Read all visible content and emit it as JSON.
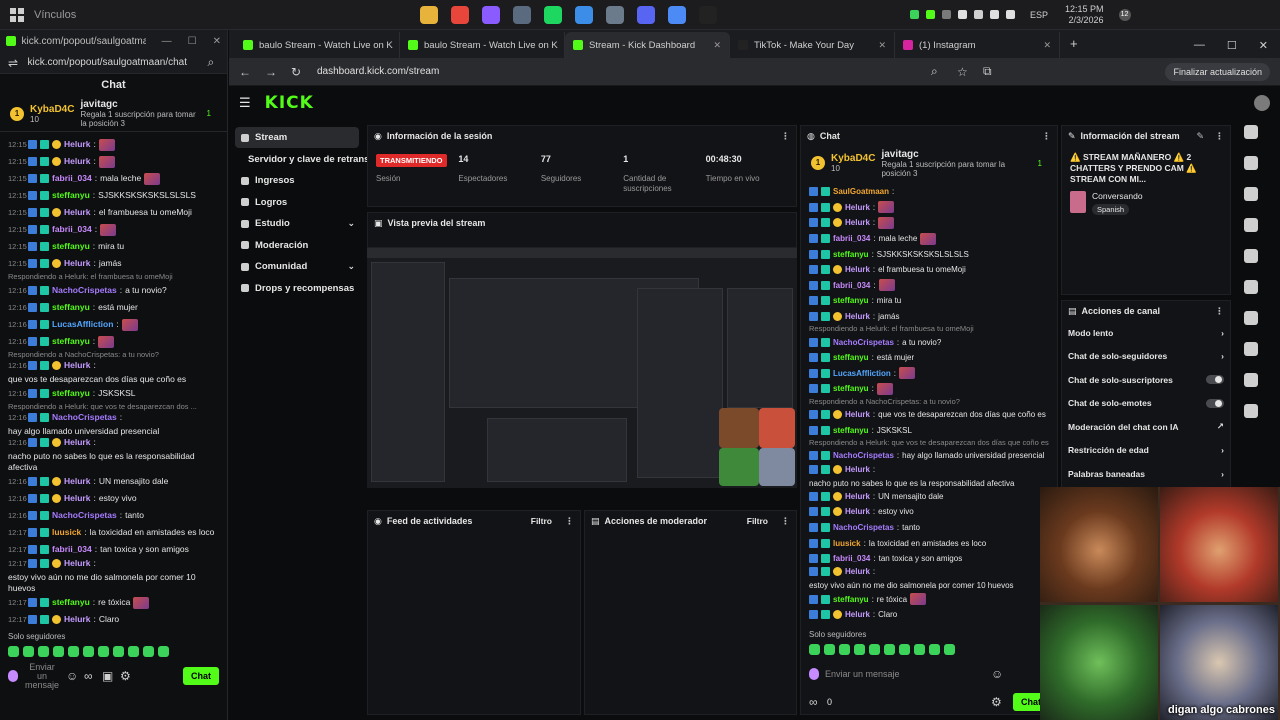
{
  "taskbar": {
    "title": "Vínculos",
    "lang": "ESP",
    "time": "12:15 PM",
    "date": "2/3/2026",
    "notif_count": "12",
    "apps": [
      "#e8b33a",
      "#e8463a",
      "#8a5cff",
      "#5a6b80",
      "#1ed760",
      "#3b8de8",
      "#6b7b8c",
      "#5865f2",
      "#4c8bf5",
      "#222222"
    ]
  },
  "popout": {
    "window_title": "kick.com/popout/saulgoatmaan...",
    "url": "kick.com/popout/saulgoatmaan/chat",
    "header": "Chat",
    "pinned_user": "KybaD4C",
    "pinned_count": "10",
    "pinned_gifter": "javitagc",
    "pinned_gift_count": "1",
    "pinned_text": "Regala 1 suscripción para tomar la posición 3",
    "messages": [
      {
        "t": "12:15",
        "user": "Helurk",
        "cls": "u-helurk",
        "text": "",
        "emote": true
      },
      {
        "t": "12:15",
        "user": "Helurk",
        "cls": "u-helurk",
        "text": "",
        "emote": true
      },
      {
        "t": "12:15",
        "user": "fabrii_034",
        "cls": "u-fabri",
        "text": "mala leche",
        "emote": true
      },
      {
        "t": "12:15",
        "user": "steffanyu",
        "cls": "u-steff",
        "text": "SJSKKSKSKSKSLSLSLS",
        "emote": false
      },
      {
        "t": "12:15",
        "user": "Helurk",
        "cls": "u-helurk",
        "text": "el frambuesa tu omeMoji",
        "emote": false
      },
      {
        "t": "12:15",
        "user": "fabrii_034",
        "cls": "u-fabri",
        "text": "",
        "emote": true
      },
      {
        "t": "12:15",
        "user": "steffanyu",
        "cls": "u-steff",
        "text": "mira tu",
        "emote": false
      },
      {
        "t": "12:15",
        "user": "Helurk",
        "cls": "u-helurk",
        "text": "jamás",
        "emote": false
      },
      {
        "reply": "Respondiendo a Helurk: el frambuesa tu omeMoji"
      },
      {
        "t": "12:16",
        "user": "NachoCrispetas",
        "cls": "u-nacho",
        "text": "a tu novio?",
        "emote": false
      },
      {
        "t": "12:16",
        "user": "steffanyu",
        "cls": "u-steff",
        "text": "está mujer",
        "emote": false
      },
      {
        "t": "12:16",
        "user": "LucasAffliction",
        "cls": "u-lucas",
        "text": "",
        "emote": true
      },
      {
        "t": "12:16",
        "user": "steffanyu",
        "cls": "u-steff",
        "text": "",
        "emote": true
      },
      {
        "reply": "Respondiendo a NachoCrispetas: a tu novio?"
      },
      {
        "t": "12:16",
        "user": "Helurk",
        "cls": "u-helurk",
        "text": "que vos te desaparezcan dos días que coño es",
        "emote": false
      },
      {
        "t": "12:16",
        "user": "steffanyu",
        "cls": "u-steff",
        "text": "JSKSKSL",
        "emote": false
      },
      {
        "reply": "Respondiendo a Helurk: que vos te desaparezcan dos ..."
      },
      {
        "t": "12:16",
        "user": "NachoCrispetas",
        "cls": "u-nacho",
        "text": "hay algo llamado universidad presencial",
        "emote": false
      },
      {
        "t": "12:16",
        "user": "Helurk",
        "cls": "u-helurk",
        "text": "nacho puto no sabes lo que es la responsabilidad afectiva",
        "emote": false
      },
      {
        "t": "12:16",
        "user": "Helurk",
        "cls": "u-helurk",
        "text": "UN mensajito dale",
        "emote": false
      },
      {
        "t": "12:16",
        "user": "Helurk",
        "cls": "u-helurk",
        "text": "estoy vivo",
        "emote": false
      },
      {
        "t": "12:16",
        "user": "NachoCrispetas",
        "cls": "u-nacho",
        "text": "tanto",
        "emote": false
      },
      {
        "t": "12:17",
        "user": "luusick",
        "cls": "u-luu",
        "text": "la toxicidad en amistades es loco",
        "emote": false
      },
      {
        "t": "12:17",
        "user": "fabrii_034",
        "cls": "u-fabri",
        "text": "tan toxica y son amigos",
        "emote": false
      },
      {
        "t": "12:17",
        "user": "Helurk",
        "cls": "u-helurk",
        "text": "estoy vivo aún no me dio salmonela por comer 10 huevos",
        "emote": false
      },
      {
        "t": "12:17",
        "user": "steffanyu",
        "cls": "u-steff",
        "text": "re tóxica",
        "emote": true
      },
      {
        "t": "12:17",
        "user": "Helurk",
        "cls": "u-helurk",
        "text": "Claro",
        "emote": false
      }
    ],
    "footer_label": "Solo seguidores",
    "input_placeholder": "Enviar un mensaje",
    "send_label": "Chat"
  },
  "browser": {
    "tabs": [
      {
        "label": "baulo Stream - Watch Live on K",
        "color": "#53fc18",
        "active": false
      },
      {
        "label": "baulo Stream - Watch Live on K",
        "color": "#53fc18",
        "active": false
      },
      {
        "label": "Stream - Kick Dashboard",
        "color": "#53fc18",
        "active": true
      },
      {
        "label": "TikTok - Make Your Day",
        "color": "#222222",
        "active": false
      },
      {
        "label": "(1) Instagram",
        "color": "#d6249f",
        "active": false
      }
    ],
    "url": "dashboard.kick.com/stream",
    "update_label": "Finalizar actualización"
  },
  "dashboard": {
    "logo": "KICK",
    "nav": [
      {
        "label": "Stream",
        "active": true,
        "chev": false
      },
      {
        "label": "Servidor y clave de retransmisión",
        "active": false,
        "chev": false
      },
      {
        "label": "Ingresos",
        "active": false,
        "chev": false
      },
      {
        "label": "Logros",
        "active": false,
        "chev": false
      },
      {
        "label": "Estudio",
        "active": false,
        "chev": true
      },
      {
        "label": "Moderación",
        "active": false,
        "chev": false
      },
      {
        "label": "Comunidad",
        "active": false,
        "chev": true
      },
      {
        "label": "Drops y recompensas",
        "active": false,
        "chev": false
      }
    ],
    "session": {
      "title": "Información de la sesión",
      "live_label": "TRANSMITIENDO",
      "session_label": "Sesión",
      "viewers": "14",
      "viewers_label": "Espectadores",
      "followers": "77",
      "followers_label": "Seguidores",
      "subs": "1",
      "subs_label": "Cantidad de suscripciones",
      "uptime": "00:48:30",
      "uptime_label": "Tiempo en vivo"
    },
    "preview_title": "Vista previa del stream",
    "feed_title": "Feed de actividades",
    "mod_title": "Acciones de moderador",
    "filter_label": "Filtro",
    "chat": {
      "title": "Chat",
      "pinned_user": "KybaD4C",
      "pinned_count": "10",
      "pinned_gifter": "javitagc",
      "pinned_gift_count": "1",
      "pinned_text": "Regala 1 suscripción para tomar la posición 3",
      "messages": [
        {
          "user": "SaulGoatmaan",
          "cls": "u-luu",
          "text": "",
          "emote": false
        },
        {
          "user": "Helurk",
          "cls": "u-helurk",
          "text": "",
          "emote": true
        },
        {
          "user": "Helurk",
          "cls": "u-helurk",
          "text": "",
          "emote": true
        },
        {
          "user": "fabrii_034",
          "cls": "u-fabri",
          "text": "mala leche",
          "emote": true
        },
        {
          "user": "steffanyu",
          "cls": "u-steff",
          "text": "SJSKKSKSKSKSLSLSLS",
          "emote": false
        },
        {
          "user": "Helurk",
          "cls": "u-helurk",
          "text": "el frambuesa tu omeMoji",
          "emote": false
        },
        {
          "user": "fabrii_034",
          "cls": "u-fabri",
          "text": "",
          "emote": true
        },
        {
          "user": "steffanyu",
          "cls": "u-steff",
          "text": "mira tu",
          "emote": false
        },
        {
          "user": "Helurk",
          "cls": "u-helurk",
          "text": "jamás",
          "emote": false
        },
        {
          "reply": "Respondiendo a Helurk: el frambuesa tu omeMoji"
        },
        {
          "user": "NachoCrispetas",
          "cls": "u-nacho",
          "text": "a tu novio?",
          "emote": false
        },
        {
          "user": "steffanyu",
          "cls": "u-steff",
          "text": "está mujer",
          "emote": false
        },
        {
          "user": "LucasAffliction",
          "cls": "u-lucas",
          "text": "",
          "emote": true
        },
        {
          "user": "steffanyu",
          "cls": "u-steff",
          "text": "",
          "emote": true
        },
        {
          "reply": "Respondiendo a NachoCrispetas: a tu novio?"
        },
        {
          "user": "Helurk",
          "cls": "u-helurk",
          "text": "que vos te desaparezcan dos días que coño es",
          "emote": false
        },
        {
          "user": "steffanyu",
          "cls": "u-steff",
          "text": "JSKSKSL",
          "emote": false
        },
        {
          "reply": "Respondiendo a Helurk: que vos te desaparezcan dos días que coño es"
        },
        {
          "user": "NachoCrispetas",
          "cls": "u-nacho",
          "text": "hay algo llamado universidad presencial",
          "emote": false
        },
        {
          "user": "Helurk",
          "cls": "u-helurk",
          "text": "nacho puto no sabes lo que es la responsabilidad afectiva",
          "emote": false
        },
        {
          "user": "Helurk",
          "cls": "u-helurk",
          "text": "UN mensajito dale",
          "emote": false
        },
        {
          "user": "Helurk",
          "cls": "u-helurk",
          "text": "estoy vivo",
          "emote": false
        },
        {
          "user": "NachoCrispetas",
          "cls": "u-nacho",
          "text": "tanto",
          "emote": false
        },
        {
          "user": "luusick",
          "cls": "u-luu",
          "text": "la toxicidad en amistades es loco",
          "emote": false
        },
        {
          "user": "fabrii_034",
          "cls": "u-fabri",
          "text": "tan toxica y son amigos",
          "emote": false
        },
        {
          "user": "Helurk",
          "cls": "u-helurk",
          "text": "estoy vivo aún no me dio salmonela por comer 10 huevos",
          "emote": false
        },
        {
          "user": "steffanyu",
          "cls": "u-steff",
          "text": "re tóxica",
          "emote": true
        },
        {
          "user": "Helurk",
          "cls": "u-helurk",
          "text": "Claro",
          "emote": false
        }
      ],
      "footer_label": "Solo seguidores",
      "input_placeholder": "Enviar un mensaje",
      "send_label": "Chat",
      "points": "0"
    },
    "stream_info": {
      "title": "Información del stream",
      "stream_title": "⚠️ STREAM MAÑANERO ⚠️ 2 CHATTERS Y PRENDO CAM ⚠️ STREAM CON MI...",
      "category": "Conversando",
      "language": "Spanish"
    },
    "actions": {
      "title": "Acciones de canal",
      "rows": [
        {
          "label": "Modo lento",
          "kind": "chev"
        },
        {
          "label": "Chat de solo-seguidores",
          "kind": "chev"
        },
        {
          "label": "Chat de solo-suscriptores",
          "kind": "toggle"
        },
        {
          "label": "Chat de solo-emotes",
          "kind": "toggle"
        },
        {
          "label": "Moderación del chat con IA",
          "kind": "ext"
        },
        {
          "label": "Restricción de edad",
          "kind": "chev"
        },
        {
          "label": "Palabras baneadas",
          "kind": "chev"
        }
      ]
    },
    "webcam_caption": "digan algo cabrones"
  }
}
